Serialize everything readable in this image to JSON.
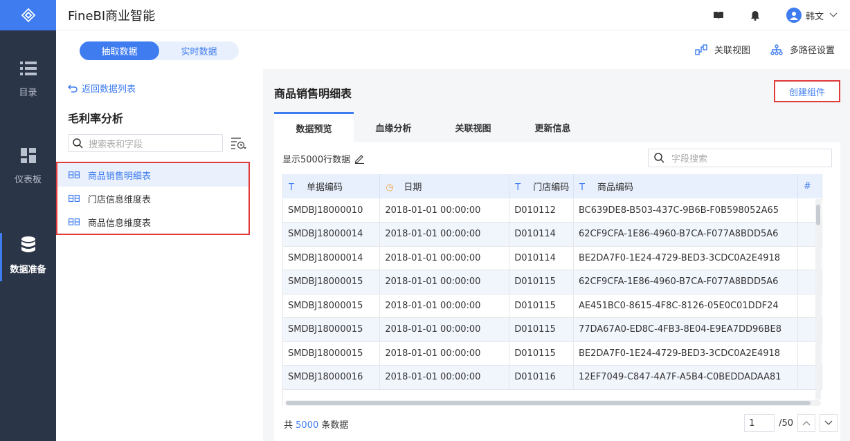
{
  "app": {
    "title": "FineBI商业智能"
  },
  "user": {
    "name": "韩文"
  },
  "nav": [
    {
      "label": "目录",
      "icon": "list-icon"
    },
    {
      "label": "仪表板",
      "icon": "dashboard-icon"
    },
    {
      "label": "数据准备",
      "icon": "database-icon"
    }
  ],
  "mode": {
    "extract": "抽取数据",
    "realtime": "实时数据"
  },
  "top_links": {
    "relation_view": "关联视图",
    "multipath": "多路径设置"
  },
  "left": {
    "back": "返回数据列表",
    "package_title": "毛利率分析",
    "search_placeholder": "搜索表和字段",
    "tables": [
      "商品销售明细表",
      "门店信息维度表",
      "商品信息维度表"
    ]
  },
  "content": {
    "table_title": "商品销售明细表",
    "create_button": "创建组件",
    "tabs": [
      "数据预览",
      "血缘分析",
      "关联视图",
      "更新信息"
    ],
    "rows_info": "显示5000行数据",
    "search_placeholder": "字段搜索",
    "columns": [
      "单据编码",
      "日期",
      "门店编码",
      "商品编码"
    ],
    "rows": [
      [
        "SMDBJ18000010",
        "2018-01-01 00:00:00",
        "D010112",
        "BC639DE8-B503-437C-9B6B-F0B598052A65"
      ],
      [
        "SMDBJ18000014",
        "2018-01-01 00:00:00",
        "D010114",
        "62CF9CFA-1E86-4960-B7CA-F077A8BDD5A6"
      ],
      [
        "SMDBJ18000014",
        "2018-01-01 00:00:00",
        "D010114",
        "BE2DA7F0-1E24-4729-BED3-3CDC0A2E4918"
      ],
      [
        "SMDBJ18000015",
        "2018-01-01 00:00:00",
        "D010115",
        "62CF9CFA-1E86-4960-B7CA-F077A8BDD5A6"
      ],
      [
        "SMDBJ18000015",
        "2018-01-01 00:00:00",
        "D010115",
        "AE451BC0-8615-4F8C-8126-05E0C01DDF24"
      ],
      [
        "SMDBJ18000015",
        "2018-01-01 00:00:00",
        "D010115",
        "77DA67A0-ED8C-4FB3-8E04-E9EA7DD96BE8"
      ],
      [
        "SMDBJ18000015",
        "2018-01-01 00:00:00",
        "D010115",
        "BE2DA7F0-1E24-4729-BED3-3CDC0A2E4918"
      ],
      [
        "SMDBJ18000016",
        "2018-01-01 00:00:00",
        "D010116",
        "12EF7049-C847-4A7F-A5B4-C0BEDDADAA81"
      ]
    ],
    "footer": {
      "prefix": "共",
      "count": "5000",
      "suffix": "条数据"
    },
    "pager": {
      "page": "1",
      "total": "/50"
    }
  },
  "colors": {
    "accent": "#3e7cf0",
    "sidebar": "#2b3548",
    "highlight": "#e03a3a"
  }
}
